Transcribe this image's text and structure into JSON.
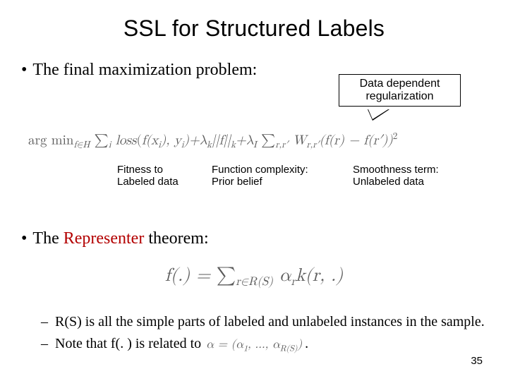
{
  "title": "SSL for Structured Labels",
  "bullet1": "The final maximization problem:",
  "callout": {
    "line1": "Data dependent",
    "line2": "regularization"
  },
  "formula_main": {
    "argmin": "arg min",
    "argmin_sub": "f∈H",
    "sum1": "∑",
    "sum1_sub": "i",
    "loss": "loss",
    "loss_args_a": "f(x",
    "loss_args_a_sub": "i",
    "loss_args_b": "), y",
    "loss_args_b_sub": "i",
    "loss_args_c": ")+λ",
    "lambdak_sub": "k",
    "norm": "||f||",
    "norm_sub": "k",
    "plus_lambdaI": "+λ",
    "lambdaI_sub": "I",
    "sum2": " ∑",
    "sum2_sub": "r,r′",
    "W": " W",
    "W_sub": "r,r′",
    "diff_a": "(f(r) − f(r′))",
    "sq": "2"
  },
  "ann": {
    "fitness_l1": "Fitness to",
    "fitness_l2": "Labeled data",
    "complex_l1": "Function complexity:",
    "complex_l2": "Prior belief",
    "smooth_l1": "Smoothness term:",
    "smooth_l2": "Unlabeled data"
  },
  "bullet2_prefix": "The ",
  "bullet2_highlight": "Representer",
  "bullet2_suffix": " theorem:",
  "formula_repr": {
    "lhs": "f(.) = ",
    "sum": "∑",
    "sum_sub": "r∈R(S)",
    "rhs_a": " α",
    "rhs_a_sub": "r",
    "rhs_b": "k(r, .)"
  },
  "sub1": "R(S) is all the simple parts of labeled and unlabeled instances in the sample.",
  "sub2_prefix": "Note that f(. ) is related to ",
  "alpha_inline": {
    "a": "α = (α",
    "s1": "1",
    "b": ", ..., α",
    "s2": "R(S)",
    "c": ")"
  },
  "sub2_suffix": ".",
  "page": "35"
}
